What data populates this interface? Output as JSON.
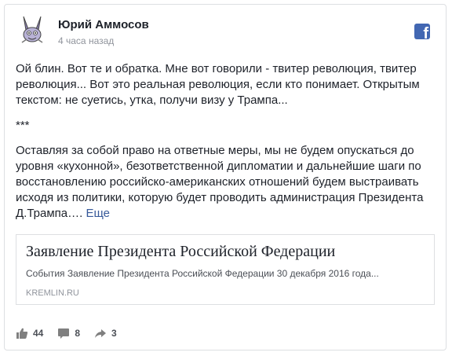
{
  "post": {
    "author": "Юрий Аммосов",
    "time": "4 часа назад",
    "paragraphs": [
      "Ой блин. Вот те и обратка. Мне вот говорили - твитер революция, твитер революция... Вот это реальная революция, если кто понимает. Открытым текстом: не суетись, утка, получи визу у Трампа...",
      "***",
      "Оставляя за собой право на ответные меры, мы не будем опускаться до уровня «кухонной», безответственной дипломатии и дальнейшие шаги по восстановлению российско-американских отношений будем выстраивать исходя из политики, которую будет проводить администрация Президента Д.Трампа…."
    ],
    "more_label": "Еще"
  },
  "link": {
    "title": "Заявление Президента Российской Федерации",
    "description": "События Заявление Президента Российской Федерации 30 декабря 2016 года...",
    "domain": "KREMLIN.RU"
  },
  "stats": {
    "likes": "44",
    "comments": "8",
    "shares": "3"
  },
  "icons": {
    "avatar": "bunny-avatar-icon",
    "brand": "facebook-icon",
    "like": "thumbs-up-icon",
    "comment": "comment-icon",
    "share": "share-arrow-icon"
  },
  "colors": {
    "brand": "#4267b2",
    "link": "#365899",
    "text": "#1d2129",
    "muted": "#90949c"
  }
}
